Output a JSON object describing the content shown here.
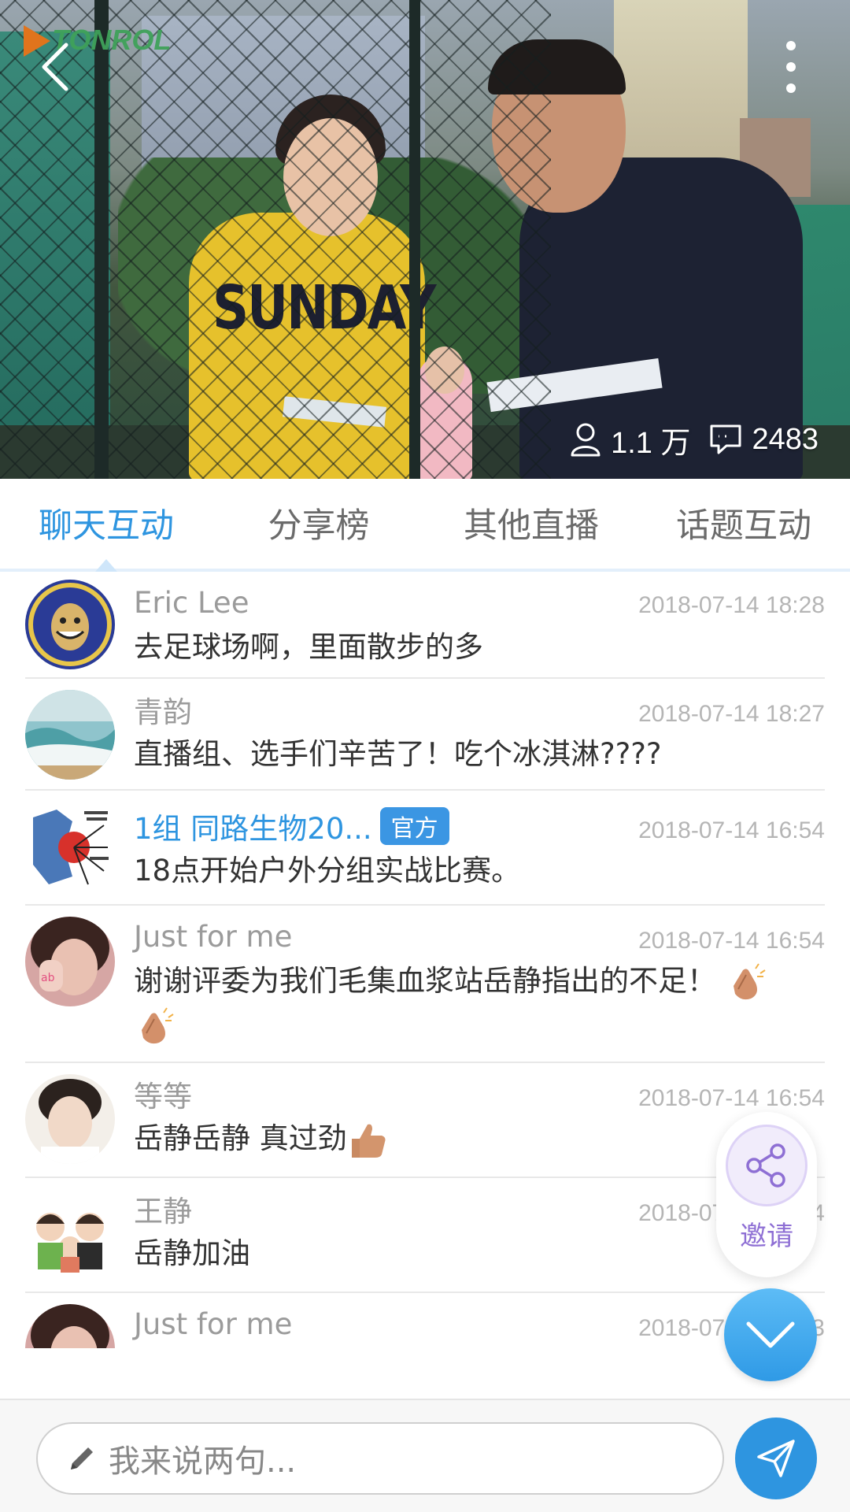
{
  "video": {
    "logo_text": "TONROL",
    "viewers": "1.1 万",
    "comments": "2483"
  },
  "tabs": [
    {
      "label": "聊天互动",
      "active": true
    },
    {
      "label": "分享榜",
      "active": false
    },
    {
      "label": "其他直播",
      "active": false
    },
    {
      "label": "话题互动",
      "active": false
    }
  ],
  "messages": [
    {
      "name": "Eric Lee",
      "time": "2018-07-14 18:28",
      "text": "去足球场啊，里面散步的多"
    },
    {
      "name": "青韵",
      "time": "2018-07-14 18:27",
      "text": "直播组、选手们辛苦了！吃个冰淇淋????"
    },
    {
      "name": "1组 同路生物20...",
      "badge": "官方",
      "time": "2018-07-14 16:54",
      "text": "18点开始户外分组实战比赛。"
    },
    {
      "name": "Just for me",
      "time": "2018-07-14 16:54",
      "text": "谢谢评委为我们毛集血浆站岳静指出的不足！"
    },
    {
      "name": "等等",
      "time": "2018-07-14 16:54",
      "text": "岳静岳静 真过劲"
    },
    {
      "name": "王静",
      "time": "2018-07-14 16:54",
      "text": "岳静加油"
    },
    {
      "name": "Just for me",
      "time": "2018-07-14 16:53",
      "text": ""
    }
  ],
  "invite": {
    "label": "邀请"
  },
  "input": {
    "placeholder": "我来说两句..."
  },
  "colors": {
    "accent": "#2e95e0",
    "invite": "#8e6fd4"
  },
  "icons": [
    "back-arrow-icon",
    "more-vertical-icon",
    "viewer-person-icon",
    "comment-icon",
    "share-icon",
    "chevron-down-icon",
    "pencil-icon",
    "send-icon"
  ]
}
